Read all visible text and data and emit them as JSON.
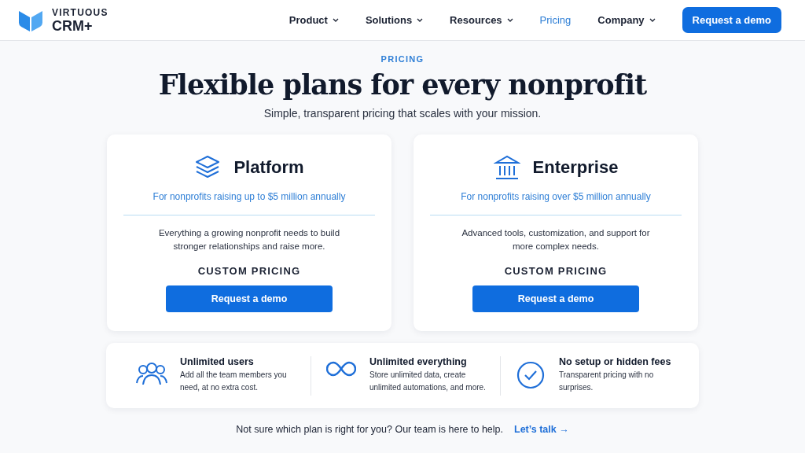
{
  "brand": {
    "top": "VIRTUOUS",
    "bottom": "CRM+"
  },
  "nav": [
    {
      "label": "Product",
      "has_menu": true,
      "selected": false
    },
    {
      "label": "Solutions",
      "has_menu": true,
      "selected": false
    },
    {
      "label": "Resources",
      "has_menu": true,
      "selected": false
    },
    {
      "label": "Pricing",
      "has_menu": false,
      "selected": true
    },
    {
      "label": "Company",
      "has_menu": true,
      "selected": false
    }
  ],
  "header_button": "Request a demo",
  "eyebrow": "PRICING",
  "title": "Flexible plans for every nonprofit",
  "subtitle": "Simple, transparent pricing that scales with your mission.",
  "plans": [
    {
      "kind": "layers",
      "name": "Platform",
      "audience": "For nonprofits raising up to $5 million annually",
      "description": "Everything a growing nonprofit needs to build stronger relationships and raise more.",
      "price": "CUSTOM PRICING",
      "button": "Request a demo"
    },
    {
      "kind": "bank",
      "name": "Enterprise",
      "audience": "For nonprofits raising over $5 million annually",
      "description": "Advanced tools, customization, and support for more complex needs.",
      "price": "CUSTOM PRICING",
      "button": "Request a demo"
    }
  ],
  "features": [
    {
      "kind": "users",
      "title": "Unlimited users",
      "text": "Add all the team members you need, at no extra cost."
    },
    {
      "kind": "infinity",
      "title": "Unlimited everything",
      "text": "Store unlimited data, create unlimited automations, and more."
    },
    {
      "kind": "check",
      "title": "No setup or hidden fees",
      "text": "Transparent pricing with no surprises."
    }
  ],
  "footer": {
    "text": "Not sure which plan is right for you? Our team is here to help.",
    "link": "Let’s talk →"
  }
}
